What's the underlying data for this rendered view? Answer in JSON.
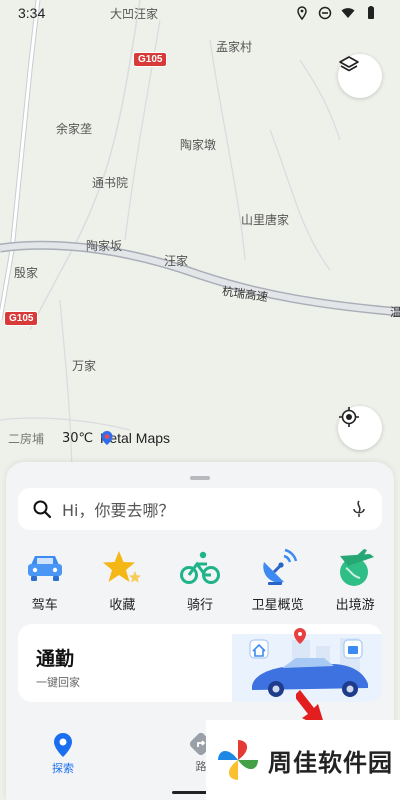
{
  "status_bar": {
    "time": "3:34"
  },
  "map": {
    "places": [
      {
        "id": "dawa",
        "text": "大凹汪家"
      },
      {
        "id": "mengjia",
        "text": "孟家村"
      },
      {
        "id": "yujia",
        "text": "余家垄"
      },
      {
        "id": "taojiadun",
        "text": "陶家墩"
      },
      {
        "id": "tongshu",
        "text": "通书院"
      },
      {
        "id": "shanli",
        "text": "山里唐家"
      },
      {
        "id": "taojiaban",
        "text": "陶家坂"
      },
      {
        "id": "wangjia",
        "text": "汪家"
      },
      {
        "id": "yinjia",
        "text": "殷家"
      },
      {
        "id": "wanjia",
        "text": "万家"
      }
    ],
    "road_label": "杭瑞高速",
    "shield_top": "G105",
    "shield_left": "G105",
    "edge_text": "温",
    "weather": {
      "place": "二房埔",
      "temp": "30℃"
    },
    "brand": "Petal Maps"
  },
  "search": {
    "placeholder": "Hi，你要去哪？"
  },
  "shortcuts": [
    {
      "label": "驾车",
      "icon": "car-icon"
    },
    {
      "label": "收藏",
      "icon": "star-icon"
    },
    {
      "label": "骑行",
      "icon": "bike-icon"
    },
    {
      "label": "卫星概览",
      "icon": "satellite-icon"
    },
    {
      "label": "出境游",
      "icon": "plane-icon"
    }
  ],
  "commute": {
    "title": "通勤",
    "subtitle": "一键回家"
  },
  "tabs": [
    {
      "label": "探索",
      "icon": "location-pin-icon",
      "active": true
    },
    {
      "label": "路",
      "icon": "route-icon",
      "active": false
    },
    {
      "label": "",
      "icon": "profile-icon",
      "active": false
    }
  ],
  "watermark": {
    "text": "周佳软件园"
  },
  "colors": {
    "accent": "#1a6ff0",
    "shield": "#d83a3a",
    "active_tab": "#1a6ff0"
  }
}
